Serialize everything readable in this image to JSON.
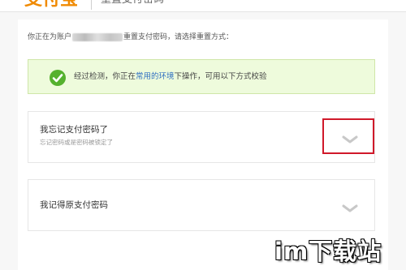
{
  "header": {
    "logo_text": "支付宝",
    "title": "重置支付密码"
  },
  "account_line": {
    "prefix": "你正在为账户",
    "suffix": "重置支付密码，请选择重置方式："
  },
  "notice": {
    "prefix": "经过检测，你正在",
    "link": "常用的环境",
    "suffix": "下操作，可用以下方式校验"
  },
  "options": [
    {
      "title": "我忘记支付密码了",
      "subtitle": "忘记密码或是密码被锁定了"
    },
    {
      "title": "我记得原支付密码",
      "subtitle": ""
    }
  ],
  "watermark": "im下载站",
  "colors": {
    "success_green": "#55b12e",
    "notice_bg": "#eefbdc",
    "link_blue": "#2f6fc1",
    "highlight_red": "#d0192a",
    "logo_orange": "#f08a00"
  }
}
